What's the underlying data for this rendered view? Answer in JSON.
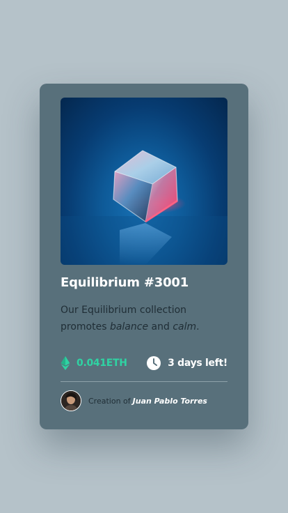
{
  "card": {
    "image_alt": "Equilibrium cube",
    "title": "Equilibrium #3001",
    "description": {
      "prefix": "Our Equilibrium collection promotes",
      "em1": "balance",
      "middle": "and",
      "em2": "calm",
      "suffix": "."
    },
    "price": "0.041ETH",
    "time_left": "3 days left!",
    "creator": {
      "label": "Creation of",
      "name": "Juan Pablo Torres"
    }
  },
  "colors": {
    "background": "#b5c2c9",
    "card": "#58707b",
    "accent_cyan": "#2fd3a3",
    "text_white": "#ffffff",
    "text_dark": "#1f2d35"
  },
  "icons": {
    "price": "ethereum-icon",
    "time": "clock-icon"
  }
}
